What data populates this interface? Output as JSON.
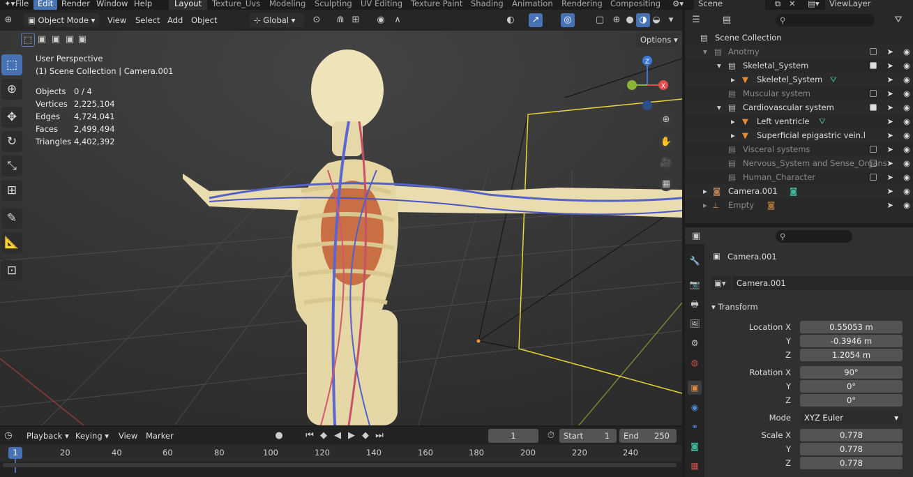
{
  "menu": {
    "items": [
      "File",
      "Edit",
      "Render",
      "Window",
      "Help"
    ],
    "selected": "Edit"
  },
  "workspaces": {
    "tabs": [
      "Layout",
      "Texture_Uvs",
      "Modeling",
      "Sculpting",
      "UV Editing",
      "Texture Paint",
      "Shading",
      "Animation",
      "Rendering",
      "Compositing"
    ],
    "active": "Layout"
  },
  "scene": {
    "name": "Scene",
    "view_layer": "ViewLayer"
  },
  "viewport_header": {
    "mode": "Object Mode",
    "view": "View",
    "select": "Select",
    "add": "Add",
    "object": "Object",
    "orientation": "Global",
    "options": "Options"
  },
  "overlay_info": {
    "perspective": "User Perspective",
    "collection": "(1) Scene Collection | Camera.001"
  },
  "stats": [
    {
      "label": "Objects",
      "value": "0 / 4"
    },
    {
      "label": "Vertices",
      "value": "2,225,104"
    },
    {
      "label": "Edges",
      "value": "4,724,041"
    },
    {
      "label": "Faces",
      "value": "2,499,494"
    },
    {
      "label": "Triangles",
      "value": "4,402,392"
    }
  ],
  "gizmo": {
    "z": "Z",
    "x": "X"
  },
  "outliner": {
    "root": "Scene Collection",
    "rows": [
      {
        "label": "Anotmy",
        "dim": true
      },
      {
        "label": "Skeletal_System",
        "dim": false
      },
      {
        "label": "Skeletel_System",
        "dim": false
      },
      {
        "label": "Muscular system",
        "dim": true
      },
      {
        "label": "Cardiovascular system",
        "dim": false
      },
      {
        "label": "Left ventricle",
        "dim": false
      },
      {
        "label": "Superficial epigastric vein.l",
        "dim": false
      },
      {
        "label": "Visceral systems",
        "dim": true
      },
      {
        "label": "Nervous_System and Sense_Organs",
        "dim": true
      },
      {
        "label": "Human_Character",
        "dim": true
      },
      {
        "label": "Camera.001",
        "dim": false
      },
      {
        "label": "Empty",
        "dim": true
      }
    ]
  },
  "properties": {
    "object_name": "Camera.001",
    "data_name": "Camera.001",
    "panel": "Transform",
    "location_label": "Location X",
    "rotation_label": "Rotation X",
    "scale_label": "Scale X",
    "y_label": "Y",
    "z_label": "Z",
    "mode_label": "Mode",
    "location": {
      "x": "0.55053 m",
      "y": "-0.3946 m",
      "z": "1.2054 m"
    },
    "rotation": {
      "x": "90°",
      "y": "0°",
      "z": "0°"
    },
    "mode": "XYZ Euler",
    "scale": {
      "x": "0.778",
      "y": "0.778",
      "z": "0.778"
    }
  },
  "timeline": {
    "playback": "Playback",
    "keying": "Keying",
    "view": "View",
    "marker": "Marker",
    "current_frame": "1",
    "start_label": "Start",
    "start": "1",
    "end_label": "End",
    "end": "250",
    "ticks": [
      "20",
      "40",
      "60",
      "80",
      "100",
      "120",
      "140",
      "160",
      "180",
      "200",
      "220",
      "240"
    ],
    "cursor_frame": "1"
  },
  "colors": {
    "accent": "#4772b3",
    "selection_outline": "#f0e03a",
    "x_axis": "#e34c4c",
    "y_axis": "#8bb635",
    "z_axis": "#3d7ad8"
  }
}
